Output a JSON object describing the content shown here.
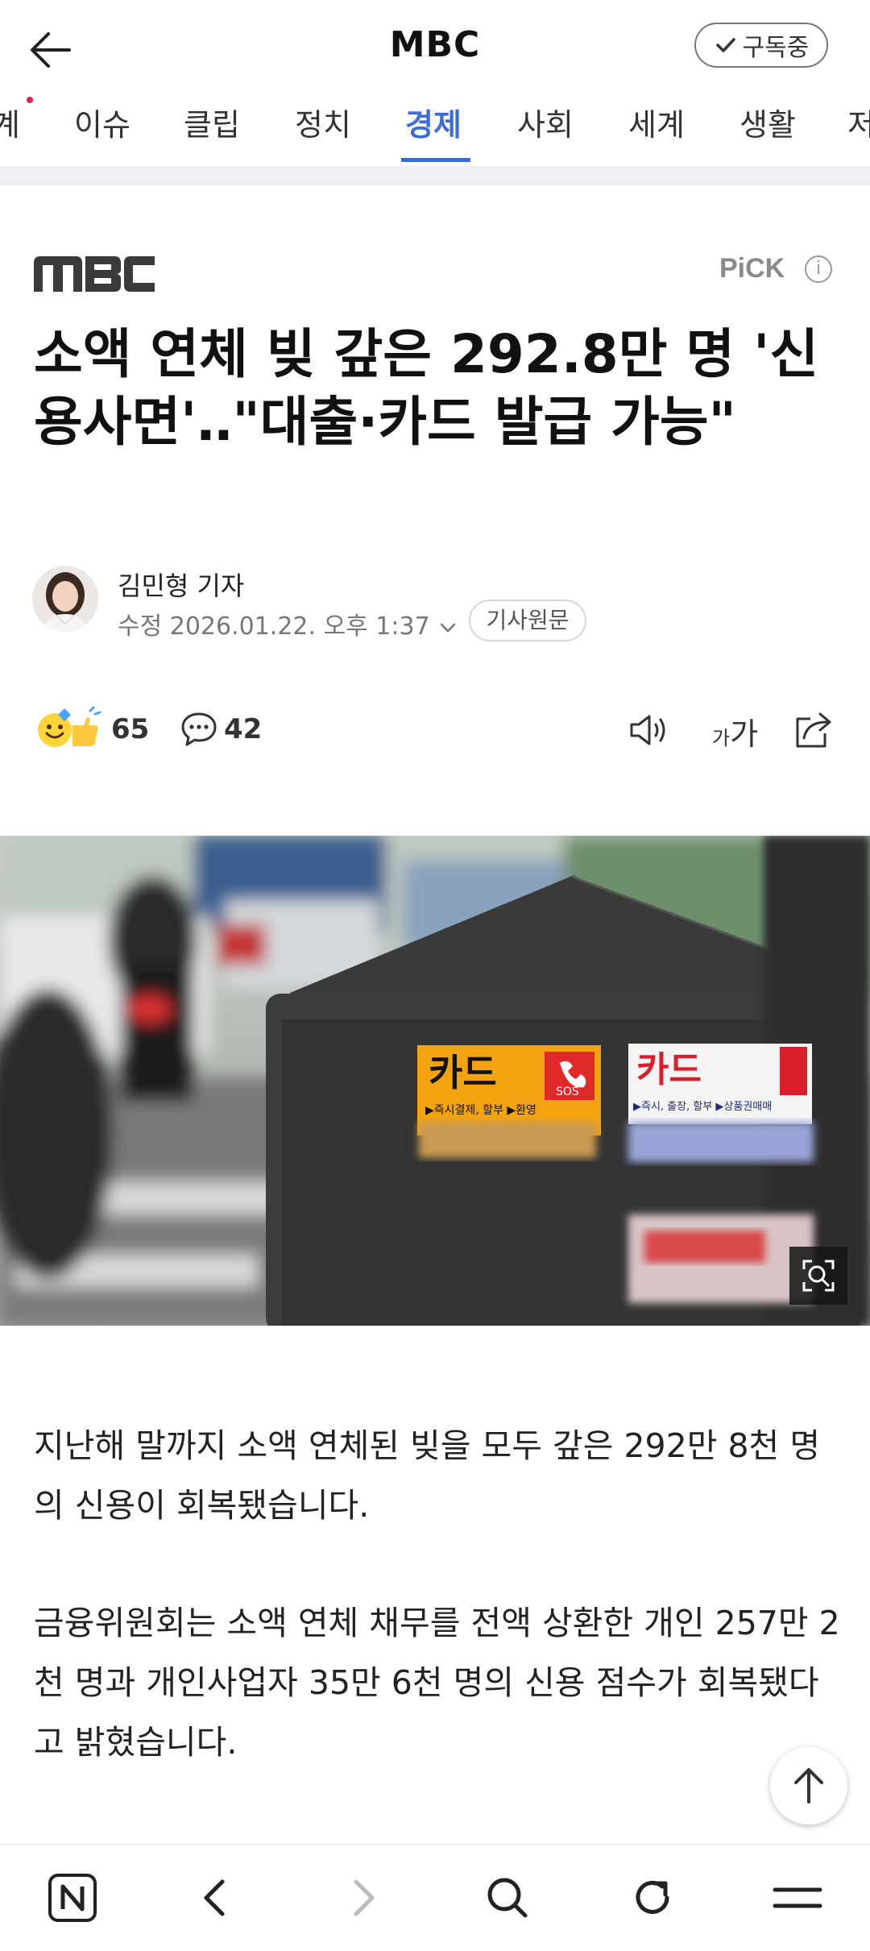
{
  "header": {
    "title": "MBC",
    "subscribe_label": "구독중"
  },
  "tabs": [
    {
      "label": "계",
      "active": false
    },
    {
      "label": "이슈",
      "active": false
    },
    {
      "label": "클립",
      "active": false
    },
    {
      "label": "정치",
      "active": false
    },
    {
      "label": "경제",
      "active": true
    },
    {
      "label": "사회",
      "active": false
    },
    {
      "label": "세계",
      "active": false
    },
    {
      "label": "생활",
      "active": false
    },
    {
      "label": "저",
      "active": false
    }
  ],
  "article": {
    "press_logo_text": "MBC",
    "pick_label": "PiCK",
    "headline": "소액 연체 빚 갚은 292.8만 명 '신용사면'‥\"대출·카드 발급 가능\"",
    "author": "김민형 기자",
    "edited_datetime": "수정 2026.01.22. 오후 1:37",
    "original_link_label": "기사원문",
    "reaction_count": "65",
    "comment_count": "42",
    "font_button_small": "가",
    "font_button_large": "가",
    "photo_sign_text_1": "카드",
    "photo_sign_text_2": "카드",
    "photo_sign_small_1": "SOS",
    "photo_sign_line_1": "▶즉시결제, 할부 ▶환영",
    "photo_sign_line_2": "▶즉시, 출장, 할부 ▶상품권매매",
    "paragraphs": [
      "지난해 말까지 소액 연체된 빚을 모두 갚은 292만 8천 명의 신용이 회복됐습니다.",
      "금융위원회는 소액 연체 채무를 전액 상환한 개인 257만 2천 명과 개인사업자 35만 6천 명의 신용 점수가 회복됐다고 밝혔습니다."
    ]
  },
  "colors": {
    "accent": "#3d6cd9",
    "new_dot": "#e0234a"
  }
}
